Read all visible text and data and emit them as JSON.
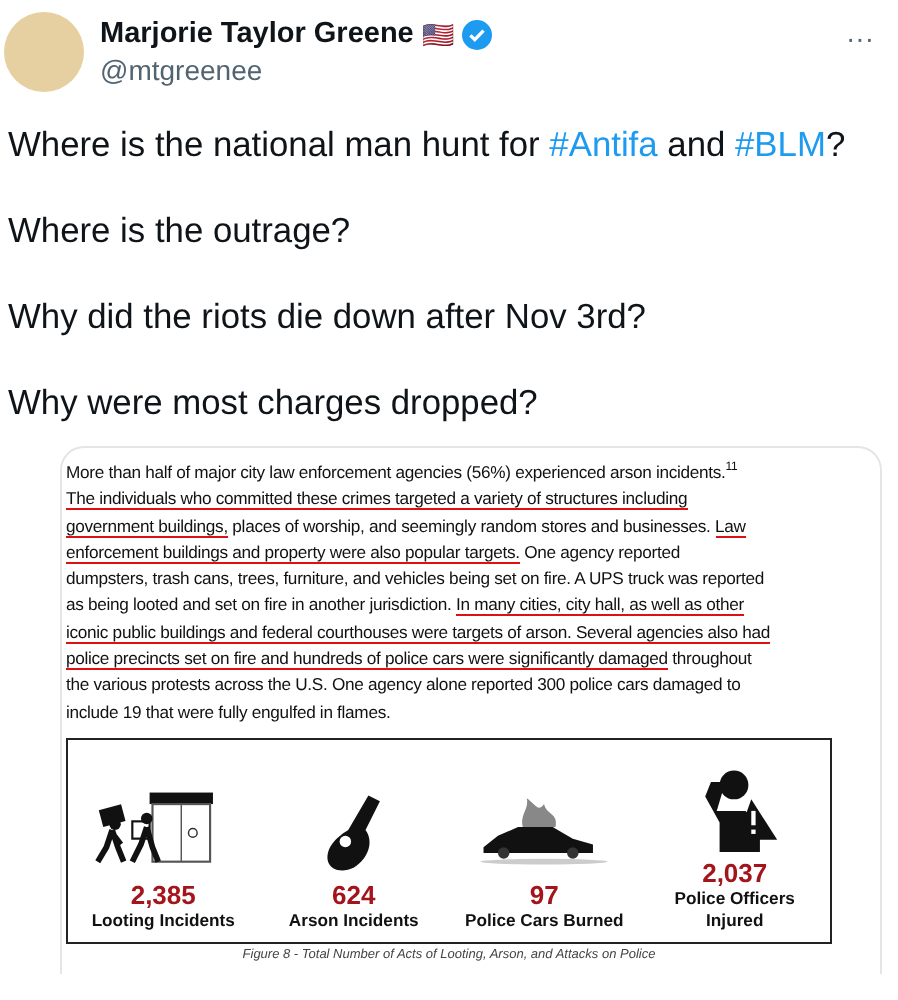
{
  "author": {
    "name": "Marjorie Taylor Greene",
    "flag": "🇺🇸",
    "verified": true,
    "handle": "@mtgreenee",
    "more": "···"
  },
  "tweet_lines": [
    [
      {
        "kind": "text",
        "text": "Where is the national man hunt for "
      },
      {
        "kind": "hashtag",
        "text": "#Antifa"
      },
      {
        "kind": "text",
        "text": " and "
      },
      {
        "kind": "hashtag",
        "text": "#BLM"
      },
      {
        "kind": "text",
        "text": "?"
      }
    ],
    [
      {
        "kind": "text",
        "text": "Where is the outrage?"
      }
    ],
    [
      {
        "kind": "text",
        "text": "Why did the riots die down after Nov 3rd?"
      }
    ],
    [
      {
        "kind": "text",
        "text": "Why were most charges dropped?"
      }
    ]
  ],
  "document": {
    "lines": [
      [
        {
          "text": "More than half of major city law enforcement agencies (56%) experienced arson incidents.$^{11}$",
          "underlined": false
        }
      ],
      [
        {
          "text": "The individuals who committed these crimes targeted a variety of structures including",
          "underlined": true
        }
      ],
      [
        {
          "text": "government buildings,",
          "underlined": true
        },
        {
          "text": " places of worship, and seemingly random stores and businesses. ",
          "underlined": false
        },
        {
          "text": "Law",
          "underlined": true
        }
      ],
      [
        {
          "text": "enforcement buildings and property were also popular targets.",
          "underlined": true
        },
        {
          "text": " One agency reported",
          "underlined": false
        }
      ],
      [
        {
          "text": "dumpsters, trash cans, trees, furniture, and vehicles being set on fire. A UPS truck was reported",
          "underlined": false
        }
      ],
      [
        {
          "text": "as being looted and set on fire in another jurisdiction. ",
          "underlined": false
        },
        {
          "text": "In many cities, city hall, as well as other",
          "underlined": true
        }
      ],
      [
        {
          "text": "iconic public buildings and federal courthouses were targets of arson. Several agencies also had",
          "underlined": true
        }
      ],
      [
        {
          "text": "police precincts set on fire and hundreds of police cars were significantly damaged",
          "underlined": true
        },
        {
          "text": " throughout",
          "underlined": false
        }
      ],
      [
        {
          "text": "the various protests across the U.S. One agency alone reported 300 police cars damaged to",
          "underlined": false
        }
      ],
      [
        {
          "text": "include 19 that were fully engulfed in flames.",
          "underlined": false
        }
      ]
    ],
    "stats": [
      {
        "kind": "looting",
        "value": "2,385",
        "label": "Looting Incidents"
      },
      {
        "kind": "arson",
        "value": "624",
        "label": "Arson Incidents"
      },
      {
        "kind": "car",
        "value": "97",
        "label": "Police Cars Burned"
      },
      {
        "kind": "injured",
        "value": "2,037",
        "label": "Police Officers Injured"
      }
    ],
    "caption": "Figure 8 - Total Number of Acts of Looting, Arson, and Attacks on Police"
  }
}
